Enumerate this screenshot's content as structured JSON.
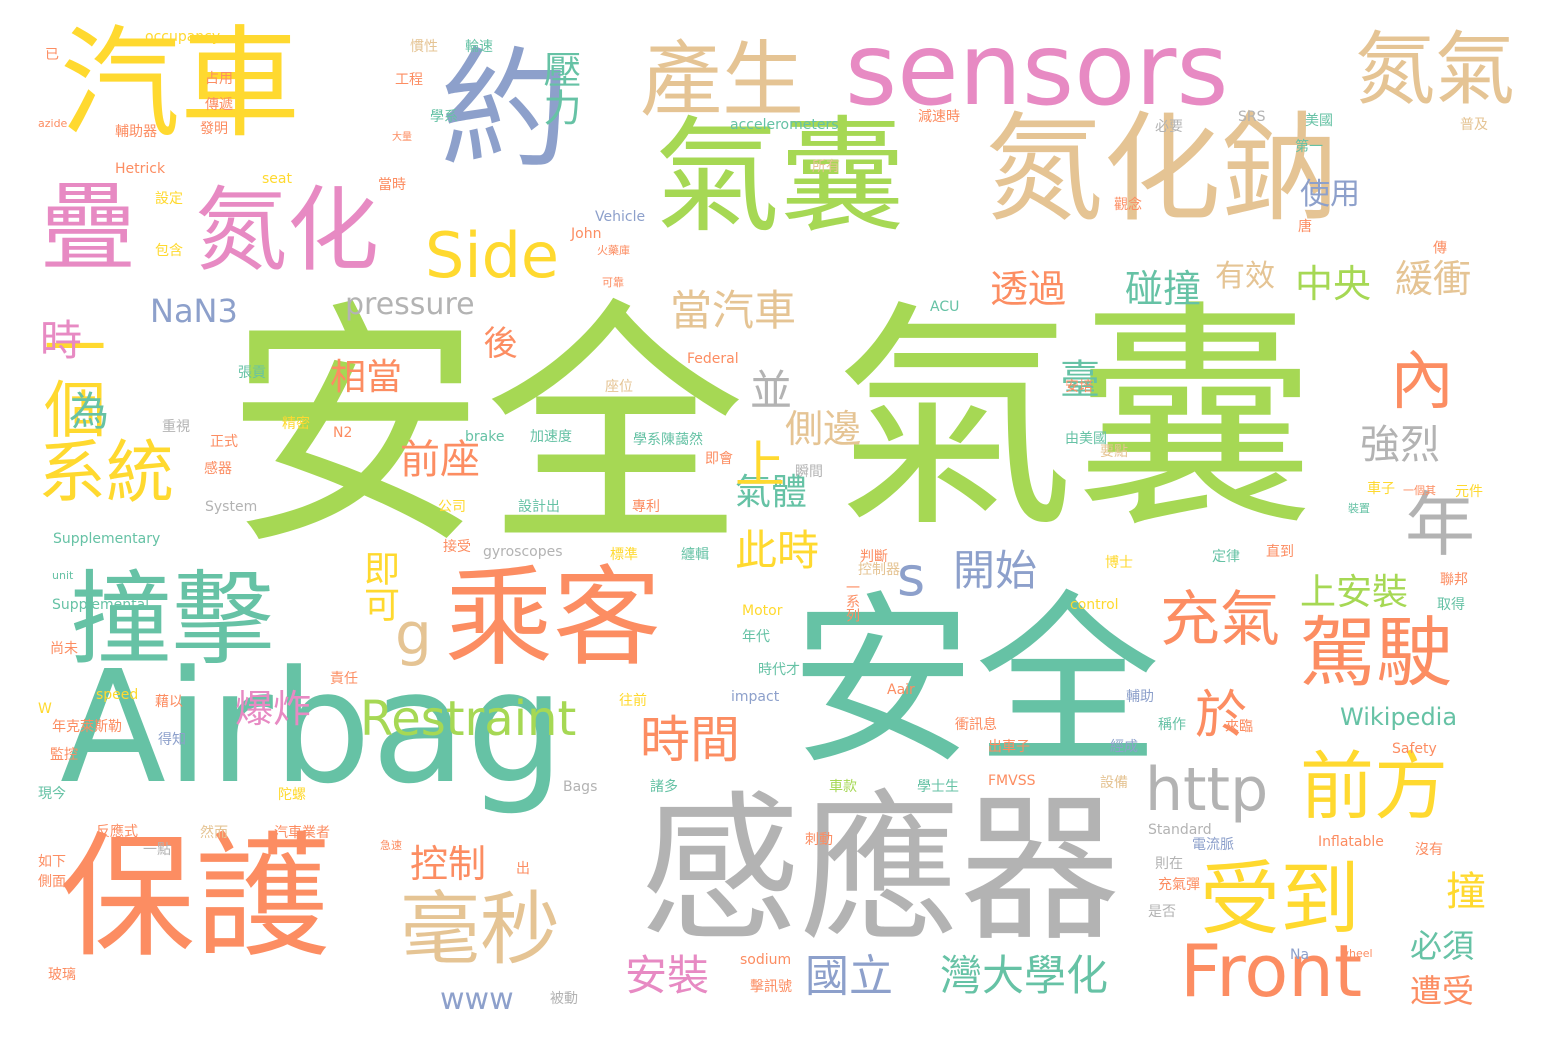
{
  "palette": {
    "green": "#a6d854",
    "teal": "#66c2a5",
    "orange": "#fc8d62",
    "blue": "#8da0cb",
    "pink": "#e78ac3",
    "yellow": "#ffd92f",
    "tan": "#e5c494",
    "gray": "#b3b3b3"
  },
  "words": [
    "安全",
    "氣囊",
    "安全",
    "感應器",
    "Airbag",
    "保護",
    "氣囊",
    "氮化鈉",
    "約",
    "汽車",
    "sensors",
    "撞擊",
    "乘客",
    "疊",
    "氮化",
    "產生",
    "氮氣",
    "毫秒",
    "受到",
    "Front",
    "駕駛",
    "前方",
    "年",
    "內",
    "充氣",
    "Side",
    "系統",
    "http",
    "Restraint",
    "時間",
    "於",
    "g",
    "s",
    "一個",
    "當汽車",
    "此時",
    "國立",
    "灣大學化",
    "安裝",
    "開始",
    "pressure",
    "壓力",
    "透過",
    "碰撞",
    "中央",
    "緩衝",
    "臺",
    "強烈",
    "相當",
    "前座",
    "側邊",
    "氣體",
    "並",
    "上",
    "NaN3",
    "為",
    "時",
    "後",
    "即可",
    "上安裝",
    "使用",
    "有效",
    "控制",
    "爆炸",
    "撞",
    "必須",
    "遭受",
    "www",
    "Wikipedia",
    "occupancy",
    "已",
    "慣性",
    "輪速",
    "工程",
    "占用",
    "傳遞",
    "學系",
    "發明",
    "輔助器",
    "azide",
    "大量",
    "Hetrick",
    "seat",
    "當時",
    "accelerometers",
    "減速時",
    "必要",
    "SRS",
    "美國",
    "普及",
    "第一",
    "所有",
    "設定",
    "包含",
    "Vehicle",
    "John",
    "火藥庫",
    "可靠",
    "觀念",
    "唐",
    "傳",
    "ACU",
    "Federal",
    "座位",
    "張貢",
    "重視",
    "正式",
    "精密",
    "感器",
    "brake",
    "加速度",
    "學系陳藹然",
    "即會",
    "瞬間",
    "System",
    "公司",
    "設計出",
    "專利",
    "Supplementary",
    "接受",
    "gyroscopes",
    "標準",
    "纏輯",
    "判斷",
    "定律",
    "直到",
    "博士",
    "聯邦",
    "控制器",
    "一系列",
    "元件",
    "一個其",
    "車子",
    "裝置",
    "要點",
    "由美國",
    "安培",
    "N2",
    "unit",
    "Supplemental",
    "Motor",
    "control",
    "取得",
    "尚未",
    "年代",
    "時代才",
    "往前",
    "Aair",
    "impact",
    "輔助",
    "稱作",
    "衝訊息",
    "出車子",
    "來臨",
    "Safety",
    "W",
    "年克萊斯勒",
    "責任",
    "藉以",
    "speed",
    "得知",
    "監控",
    "現今",
    "陀螺",
    "諸多",
    "Bags",
    "車款",
    "學士生",
    "FMVSS",
    "經成",
    "設備",
    "反應式",
    "然而",
    "汽車業者",
    "一點",
    "急速",
    "Standard",
    "電流脈",
    "Inflatable",
    "沒有",
    "如下",
    "側面",
    "出",
    "刺動",
    "則在",
    "充氣彈",
    "是否",
    "玻璃",
    "被動",
    "擊訊號",
    "sodium",
    "Na",
    "wheel"
  ]
}
